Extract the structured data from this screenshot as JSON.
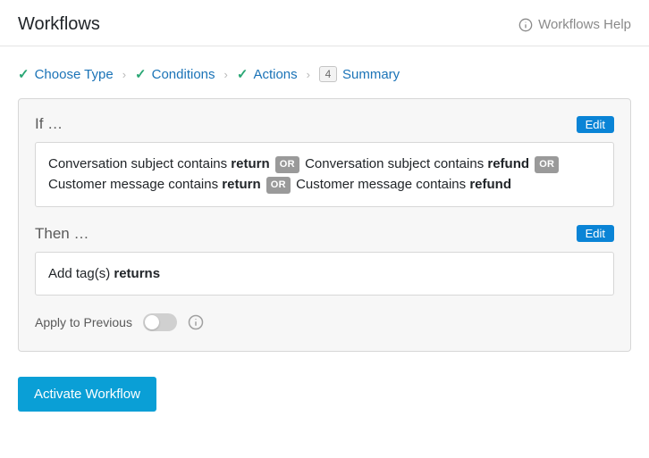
{
  "header": {
    "title": "Workflows",
    "help_label": "Workflows Help"
  },
  "breadcrumb": {
    "steps": [
      {
        "label": "Choose Type",
        "done": true
      },
      {
        "label": "Conditions",
        "done": true
      },
      {
        "label": "Actions",
        "done": true
      },
      {
        "label": "Summary",
        "done": false,
        "number": "4"
      }
    ]
  },
  "summary": {
    "if_label": "If …",
    "then_label": "Then …",
    "edit_label": "Edit",
    "or_label": "OR",
    "conditions": [
      {
        "prefix": "Conversation subject contains ",
        "value": "return"
      },
      {
        "prefix": "Conversation subject contains ",
        "value": "refund"
      },
      {
        "prefix": "Customer message contains ",
        "value": "return"
      },
      {
        "prefix": "Customer message contains ",
        "value": "refund"
      }
    ],
    "action_prefix": "Add tag(s) ",
    "action_value": "returns",
    "apply_label": "Apply to Previous",
    "apply_enabled": false
  },
  "activate_label": "Activate Workflow"
}
